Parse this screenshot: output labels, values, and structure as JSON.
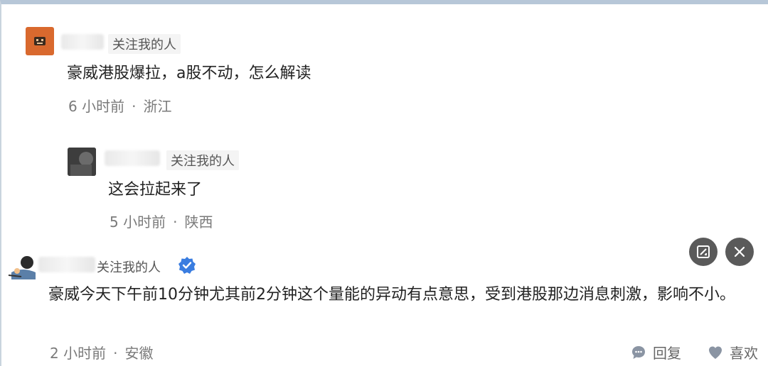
{
  "comments": [
    {
      "tag": "关注我的人",
      "text": "豪威港股爆拉，a股不动，怎么解读",
      "time": "6 小时前",
      "location": "浙江"
    },
    {
      "tag": "关注我的人",
      "text": "这会拉起来了",
      "time": "5 小时前",
      "location": "陕西"
    },
    {
      "tag": "关注我的人",
      "text": "豪威今天下午前10分钟尤其前2分钟这个量能的异动有点意思，受到港股那边消息刺激，影响不小。",
      "time": "2 小时前",
      "location": "安徽",
      "reply_label": "回复",
      "like_label": "喜欢"
    }
  ],
  "icons": {
    "edit": "edit-icon",
    "close": "close-icon",
    "verified": "verified-badge-icon",
    "reply": "comment-bubble-icon",
    "like": "heart-icon"
  },
  "colors": {
    "verified": "#3a7de0",
    "floating_button": "#5a5a5a"
  }
}
